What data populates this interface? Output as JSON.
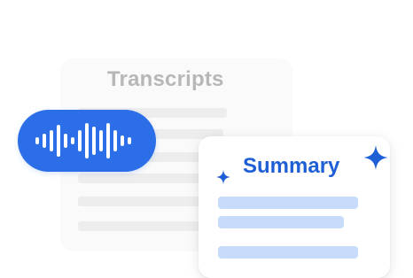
{
  "transcripts": {
    "title": "Transcripts"
  },
  "summary": {
    "title": "Summary"
  },
  "icons": {
    "audio": "audio-waveform-icon",
    "sparkle": "sparkle-icon"
  },
  "colors": {
    "accent": "#2b6ee8",
    "summary_title": "#1f5fd6",
    "summary_lines": "#c9dbfb",
    "transcript_lines": "#ededed",
    "transcripts_title": "#b7b7b7"
  }
}
